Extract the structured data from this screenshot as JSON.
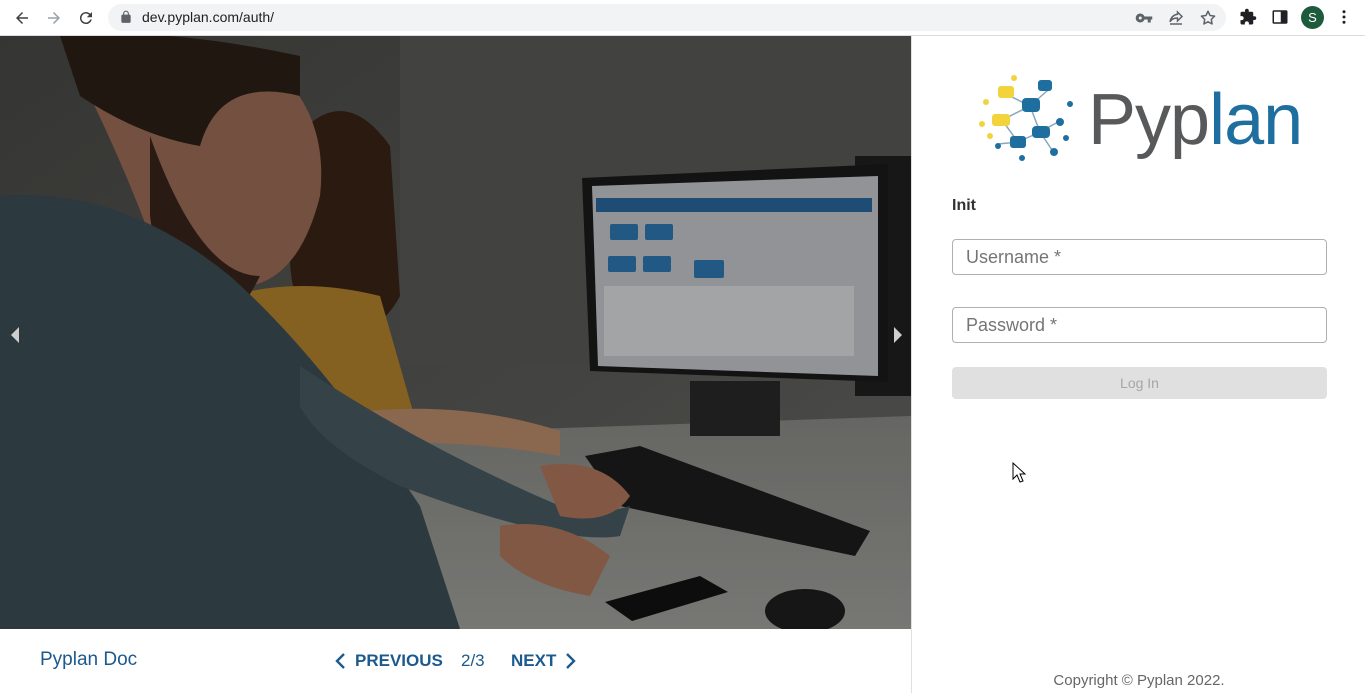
{
  "browser": {
    "url": "dev.pyplan.com/auth/",
    "profile_initial": "S",
    "icons": [
      "back-icon",
      "forward-icon",
      "reload-icon",
      "lock-icon",
      "key-icon",
      "share-icon",
      "star-icon",
      "extensions-icon",
      "side-panel-icon",
      "menu-icon"
    ]
  },
  "carousel": {
    "doc_link": "Pyplan Doc",
    "previous_label": "PREVIOUS",
    "next_label": "NEXT",
    "page_indicator": "2/3"
  },
  "login": {
    "logo_text_part1": "Pyp",
    "logo_text_part2": "lan",
    "heading": "Init",
    "username_placeholder": "Username *",
    "password_placeholder": "Password *",
    "submit_label": "Log In",
    "copyright": "Copyright © Pyplan 2022."
  },
  "colors": {
    "brand_blue": "#1e6fa0",
    "brand_gray": "#58595b",
    "brand_yellow": "#f3d33c",
    "link_blue": "#1c5a8e"
  }
}
